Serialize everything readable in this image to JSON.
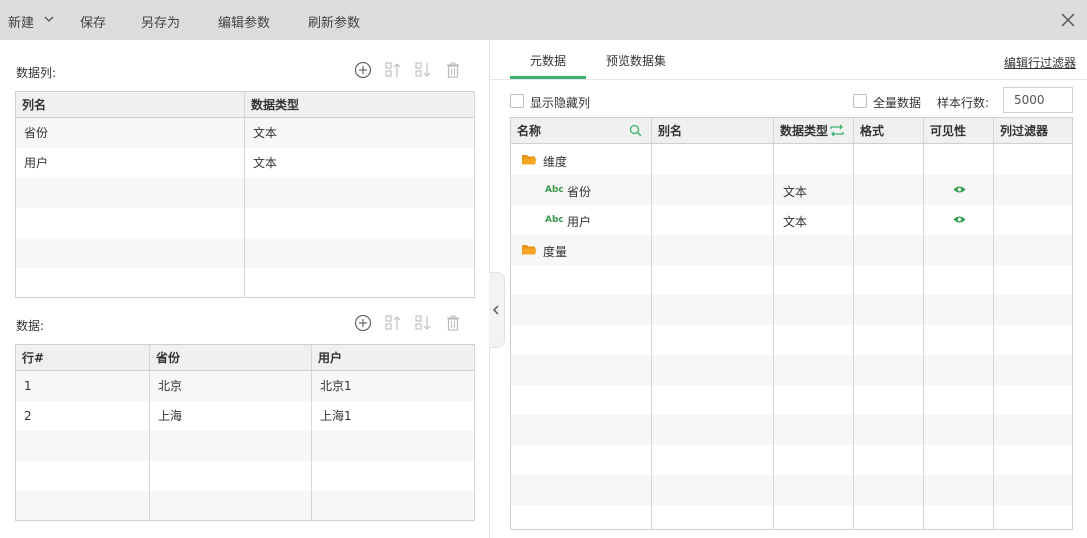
{
  "toolbar": {
    "new_label": "新建",
    "save_label": "保存",
    "save_as_label": "另存为",
    "edit_params_label": "编辑参数",
    "refresh_params_label": "刷新参数"
  },
  "columns_section": {
    "label": "数据列:",
    "headers": [
      "列名",
      "数据类型"
    ],
    "rows": [
      {
        "name": "省份",
        "type": "文本"
      },
      {
        "name": "用户",
        "type": "文本"
      }
    ]
  },
  "data_section": {
    "label": "数据:",
    "headers": [
      "行#",
      "省份",
      "用户"
    ],
    "rows": [
      {
        "row": "1",
        "province": "北京",
        "user": "北京1"
      },
      {
        "row": "2",
        "province": "上海",
        "user": "上海1"
      }
    ]
  },
  "right": {
    "tabs": [
      "元数据",
      "预览数据集"
    ],
    "active_tab": "元数据",
    "edit_filter_label": "编辑行过滤器",
    "show_hidden_label": "显示隐藏列",
    "full_data_label": "全量数据",
    "sample_rows_label": "样本行数:",
    "sample_rows_value": "5000",
    "meta_headers": [
      "名称",
      "别名",
      "数据类型",
      "格式",
      "可见性",
      "列过滤器"
    ],
    "tree": {
      "dimension_label": "维度",
      "measure_label": "度量",
      "fields": [
        {
          "badge": "Abc",
          "name": "省份",
          "type": "文本"
        },
        {
          "badge": "Abc",
          "name": "用户",
          "type": "文本"
        }
      ]
    }
  },
  "colors": {
    "accent": "#3bb36e",
    "folder": "#f5a623",
    "toolbar_bg": "#dcdcdc"
  }
}
